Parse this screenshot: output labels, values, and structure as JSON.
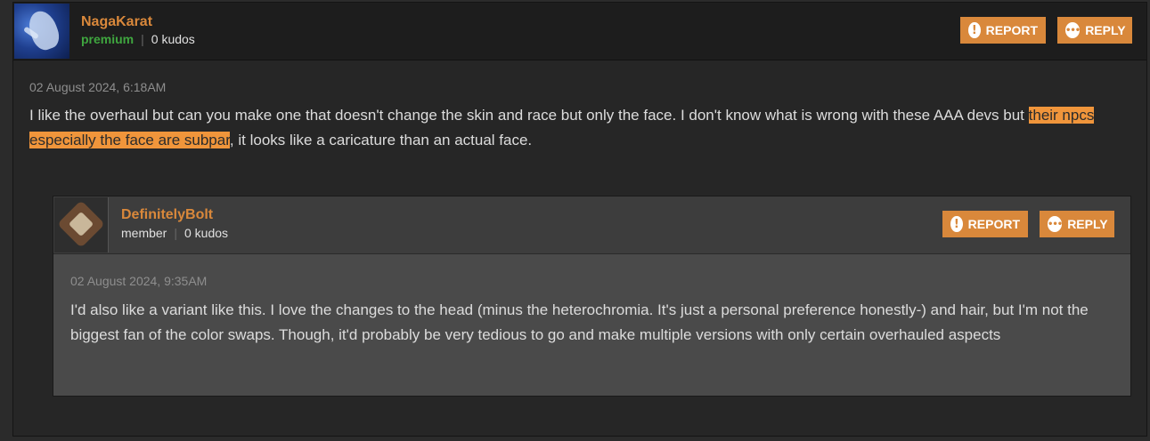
{
  "comment": {
    "username": "NagaKarat",
    "role": "premium",
    "kudos": "0 kudos",
    "separator": "|",
    "report_label": "REPORT",
    "reply_label": "REPLY",
    "date": "02 August 2024, 6:18AM",
    "text_before": "I like the overhaul but can you make one that doesn't change the skin and race but only the face. I don't know what is wrong with these AAA devs but ",
    "text_highlight": "their npcs especially the face are subpar",
    "text_after": ", it looks like a caricature than an actual face."
  },
  "reply": {
    "username": "DefinitelyBolt",
    "role": "member",
    "kudos": "0 kudos",
    "separator": "|",
    "report_label": "REPORT",
    "reply_label": "REPLY",
    "date": "02 August 2024, 9:35AM",
    "text": "I'd also like a variant like this. I love the changes to the head (minus the heterochromia. It's just a personal preference honestly-) and hair, but I'm not the biggest fan of the color swaps. Though, it'd probably be very tedious to go and make multiple versions with only certain overhauled aspects"
  },
  "icons": {
    "report": "alert-circle-icon",
    "reply": "speech-bubble-icon"
  },
  "colors": {
    "accent": "#d9883b",
    "premium": "#3fa63f",
    "highlight": "#f0953b"
  }
}
